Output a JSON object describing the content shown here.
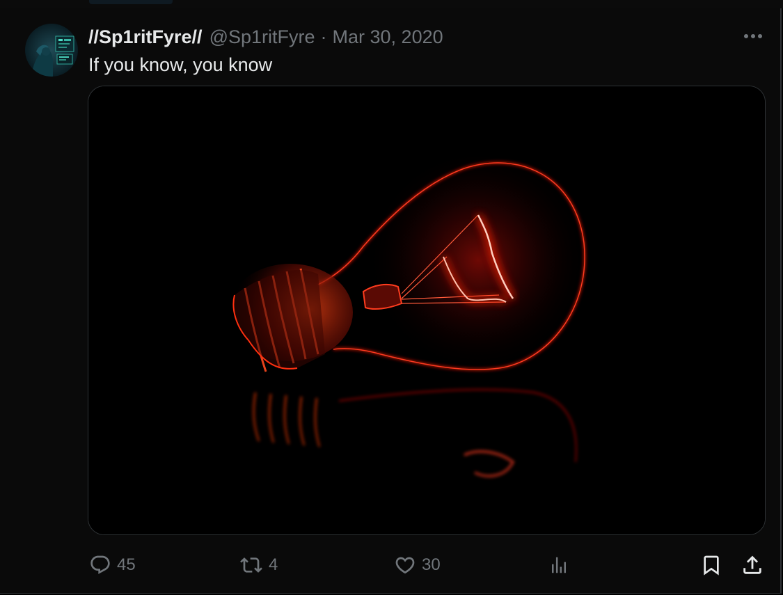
{
  "tweet": {
    "display_name": "//Sp1ritFyre//",
    "handle": "@Sp1ritFyre",
    "separator": "·",
    "date": "Mar 30, 2020",
    "text": "If you know, you know"
  },
  "actions": {
    "reply_count": "45",
    "retweet_count": "4",
    "like_count": "30"
  },
  "icons": {
    "reply": "reply-icon",
    "retweet": "retweet-icon",
    "like": "heart-icon",
    "views": "views-chart-icon",
    "bookmark": "bookmark-icon",
    "share": "share-icon",
    "more": "more-dots-icon"
  },
  "colors": {
    "background": "#000000",
    "text_primary": "#e7e9ea",
    "text_secondary": "#71767b",
    "border": "#2f3336",
    "bulb_red": "#ff2a1a"
  }
}
